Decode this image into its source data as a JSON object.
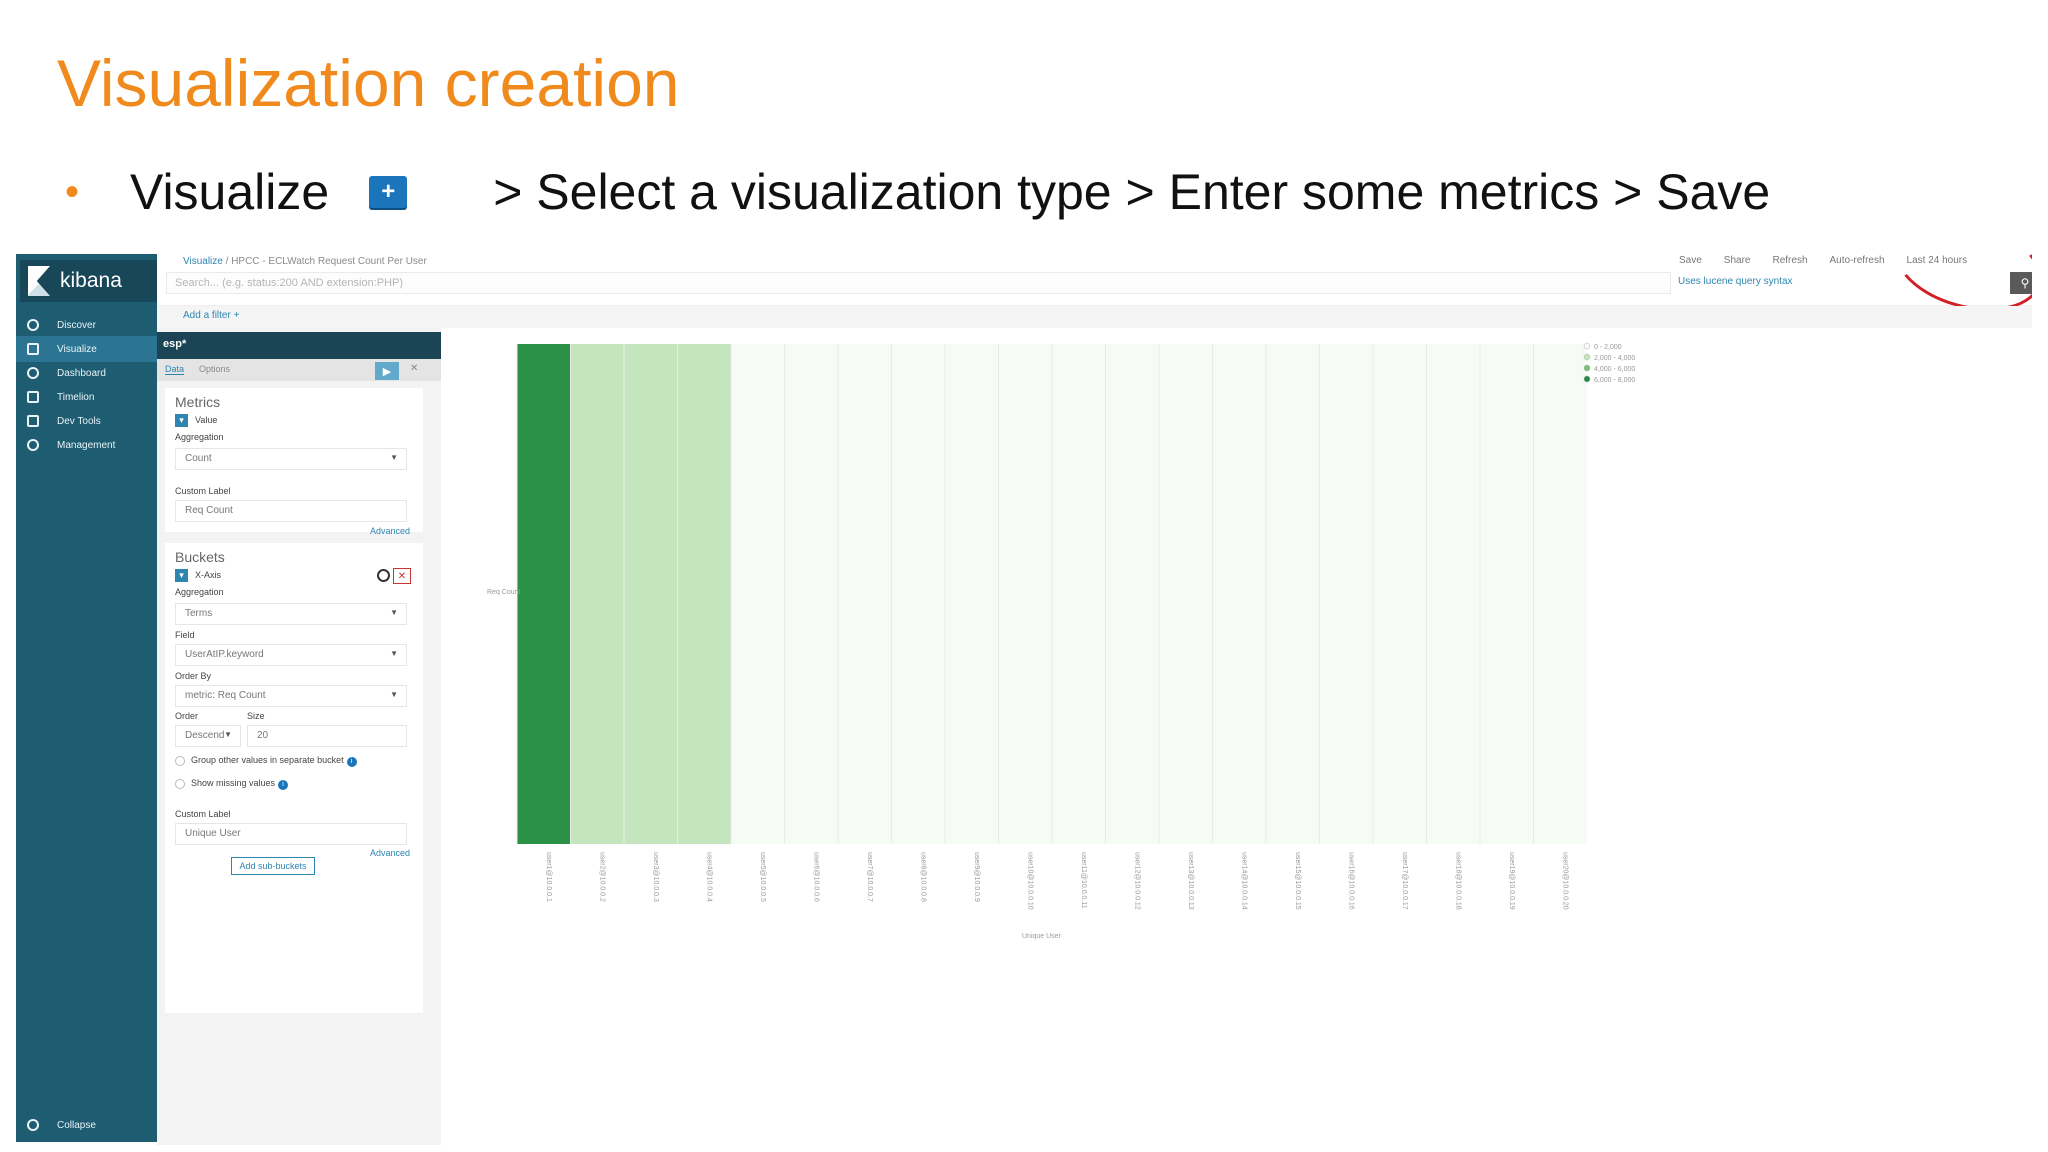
{
  "slide": {
    "title": "Visualization creation",
    "bullet_word": "Visualize",
    "plus_button": "+",
    "bullet_rest": "> Select a visualization type > Enter some metrics > Save"
  },
  "kibana": {
    "logo": "kibana",
    "nav": [
      {
        "label": "Discover",
        "icon": "compass-icon"
      },
      {
        "label": "Visualize",
        "icon": "bar-chart-icon"
      },
      {
        "label": "Dashboard",
        "icon": "dashboard-icon"
      },
      {
        "label": "Timelion",
        "icon": "shield-icon"
      },
      {
        "label": "Dev Tools",
        "icon": "wrench-icon"
      },
      {
        "label": "Management",
        "icon": "gear-icon"
      }
    ],
    "collapse": "Collapse",
    "breadcrumb": {
      "root": "Visualize",
      "sep": "/",
      "current": "HPCC - ECLWatch Request Count Per User"
    },
    "search_placeholder": "Search... (e.g. status:200 AND extension:PHP)",
    "lucene_link": "Uses lucene query syntax",
    "top_actions": [
      "Save",
      "Share",
      "Refresh",
      "Auto-refresh",
      "Last 24 hours"
    ],
    "add_filter": "Add a filter +",
    "index": "esp*",
    "tabs": [
      "Data",
      "Options"
    ],
    "apply_icon": "play-icon",
    "discard_icon": "close-icon",
    "metrics": {
      "title": "Metrics",
      "item": "Value",
      "aggregation_label": "Aggregation",
      "aggregation_value": "Count",
      "custom_label_label": "Custom Label",
      "custom_label_value": "Req Count",
      "advanced": "Advanced"
    },
    "buckets": {
      "title": "Buckets",
      "item": "X-Axis",
      "aggregation_label": "Aggregation",
      "aggregation_value": "Terms",
      "field_label": "Field",
      "field_value": "UserAtIP.keyword",
      "order_by_label": "Order By",
      "order_by_value": "metric: Req Count",
      "order_label": "Order",
      "order_value": "Descend",
      "size_label": "Size",
      "size_value": "20",
      "group_other": "Group other values in separate bucket",
      "show_missing": "Show missing values",
      "custom_label_label": "Custom Label",
      "custom_label_value": "Unique User",
      "advanced": "Advanced",
      "add_sub": "Add sub-buckets"
    }
  },
  "chart_data": {
    "type": "heatmap",
    "ylabel": "Req Count",
    "xlabel": "Unique User",
    "colors": [
      "#2a9147",
      "#c4e5bd",
      "#f7fbf5"
    ],
    "legend": [
      "0 - 2,000",
      "2,000 - 4,000",
      "4,000 - 6,000",
      "6,000 - 8,000"
    ],
    "legend_colors": [
      "#f7fbf5",
      "#c4e5bd",
      "#74c476",
      "#238b45"
    ],
    "cell_levels": [
      3,
      1,
      1,
      1,
      0,
      0,
      0,
      0,
      0,
      0,
      0,
      0,
      0,
      0,
      0,
      0,
      0,
      0,
      0,
      0
    ],
    "categories": [
      "user1@10.0.0.1",
      "user2@10.0.0.2",
      "user3@10.0.0.3",
      "user4@10.0.0.4",
      "user5@10.0.0.5",
      "user6@10.0.0.6",
      "user7@10.0.0.7",
      "user8@10.0.0.8",
      "user9@10.0.0.9",
      "user10@10.0.0.10",
      "user11@10.0.0.11",
      "user12@10.0.0.12",
      "user13@10.0.0.13",
      "user14@10.0.0.14",
      "user15@10.0.0.15",
      "user16@10.0.0.16",
      "user17@10.0.0.17",
      "user18@10.0.0.18",
      "user19@10.0.0.19",
      "user20@10.0.0.20"
    ]
  }
}
